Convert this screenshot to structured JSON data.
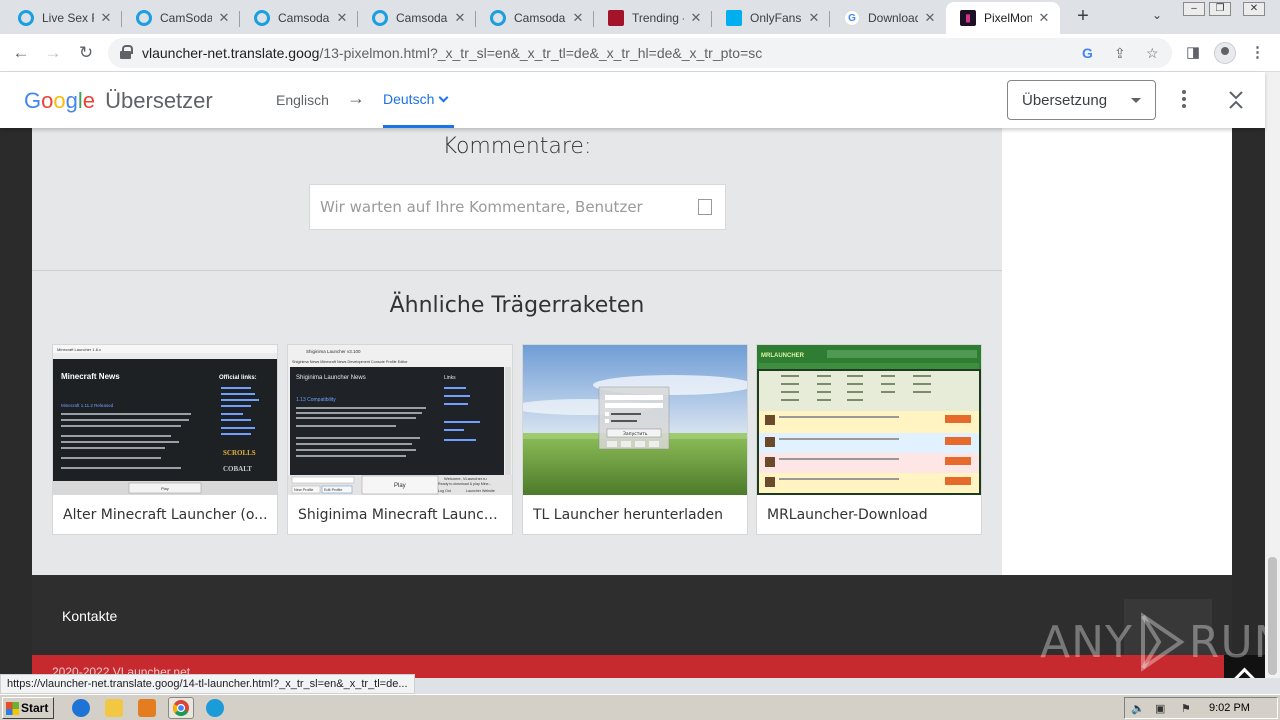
{
  "tabs": [
    {
      "label": "Live Sex Fr",
      "icon": "camsoda-icon",
      "fav": "ring"
    },
    {
      "label": "CamSoda.c",
      "icon": "camsoda-icon",
      "fav": "ring"
    },
    {
      "label": "Camsoda.c",
      "icon": "camsoda-icon",
      "fav": "ring"
    },
    {
      "label": "Camsoda.c",
      "icon": "camsoda-icon",
      "fav": "ring"
    },
    {
      "label": "Camsoda.c",
      "icon": "camsoda-icon",
      "fav": "ring"
    },
    {
      "label": "Trending - l",
      "icon": "trending-site-icon",
      "fav": "red"
    },
    {
      "label": "OnlyFans l",
      "icon": "onlyfans-icon",
      "fav": "blue"
    },
    {
      "label": "Download (",
      "icon": "google-icon",
      "fav": "google"
    },
    {
      "label": "PixelMon L",
      "icon": "pixelmon-icon",
      "fav": "pm",
      "active": true
    }
  ],
  "browser": {
    "url_host": "vlauncher-net.translate.goog",
    "url_path": "/13-pixelmon.html?_x_tr_sl=en&_x_tr_tl=de&_x_tr_hl=de&_x_tr_pto=sc"
  },
  "translate_bar": {
    "logo": {
      "g": "G",
      "o1": "o",
      "o2": "o",
      "g2": "g",
      "l": "l",
      "e": "e"
    },
    "product": "Übersetzer",
    "source_lang": "Englisch",
    "arrow": "→",
    "target_lang": "Deutsch",
    "view_mode": "Übersetzung"
  },
  "page": {
    "comments_title": "Kommentare:",
    "comment_placeholder": "Wir warten auf Ihre Kommentare, Benutzer",
    "similar_title": "Ähnliche Trägerraketen",
    "cards": [
      {
        "label": "Alter Minecraft Launcher (o..."
      },
      {
        "label": "Shiginima Minecraft Launch..."
      },
      {
        "label": "TL Launcher herunterladen"
      },
      {
        "label": "MRLauncher-Download"
      }
    ],
    "thumb1": {
      "window_title": "Minecraft Launcher 1.6.x",
      "heading": "Minecraft News",
      "side": "Official links:",
      "news_title": "Minecraft 1.11.2 Released",
      "footer": "Play",
      "brand1": "SCROLLS",
      "brand2": "COBALT"
    },
    "thumb2": {
      "window_title": "Shiginima Launcher v3.100",
      "menu": "Shiginima News   Minecraft News   Development Console   Profile Editor",
      "heading": "Shiginima Launcher News",
      "side": "Links",
      "compat": "1.13 Compatibility",
      "play": "Play",
      "welcome": "Welcome, VLauncher.ru",
      "ready": "Ready to download & play Mine...",
      "new_profile": "New Profile",
      "edit_profile": "Edit Profile",
      "logout": "Log Out",
      "website": "Launcher Website"
    },
    "thumb3": {
      "button": "Запустить"
    },
    "thumb4": {
      "logo": "MRLAUNCHER"
    },
    "contacts": "Kontakte",
    "copyright": "2020-2022 VLauncher.net"
  },
  "watermark": {
    "left": "ANY",
    "right": "RUN"
  },
  "status_url": "https://vlauncher-net.translate.goog/14-tl-launcher.html?_x_tr_sl=en&_x_tr_tl=de...",
  "taskbar": {
    "start": "Start",
    "clock": "9:02 PM"
  },
  "colors": {
    "accent": "#1a73e8",
    "footer_red": "#c62a2f",
    "footer_dark": "#2e2e2e"
  }
}
